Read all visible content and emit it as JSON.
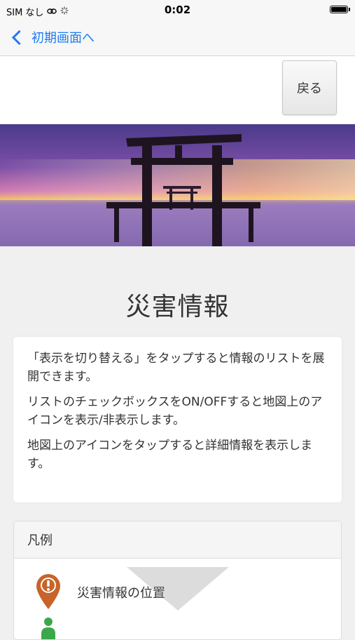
{
  "status_bar": {
    "carrier": "SIM なし",
    "time": "0:02"
  },
  "nav": {
    "back_label": "初期画面へ"
  },
  "top": {
    "back_button_label": "戻る"
  },
  "page": {
    "title": "災害情報"
  },
  "info": {
    "paragraphs": [
      "「表示を切り替える」をタップすると情報のリストを展開できます。",
      "リストのチェックボックスをON/OFFすると地図上のアイコンを表示/非表示します。",
      "地図上のアイコンをタップすると詳細情報を表示します。"
    ]
  },
  "legend": {
    "header": "凡例",
    "items": [
      {
        "icon": "disaster-pin-icon",
        "label": "災害情報の位置",
        "color": "#c8642a"
      },
      {
        "icon": "person-icon",
        "label": "",
        "color": "#3aa84a"
      }
    ]
  },
  "colors": {
    "accent": "#1e7cf2",
    "pin": "#c8642a",
    "person": "#3aa84a"
  }
}
